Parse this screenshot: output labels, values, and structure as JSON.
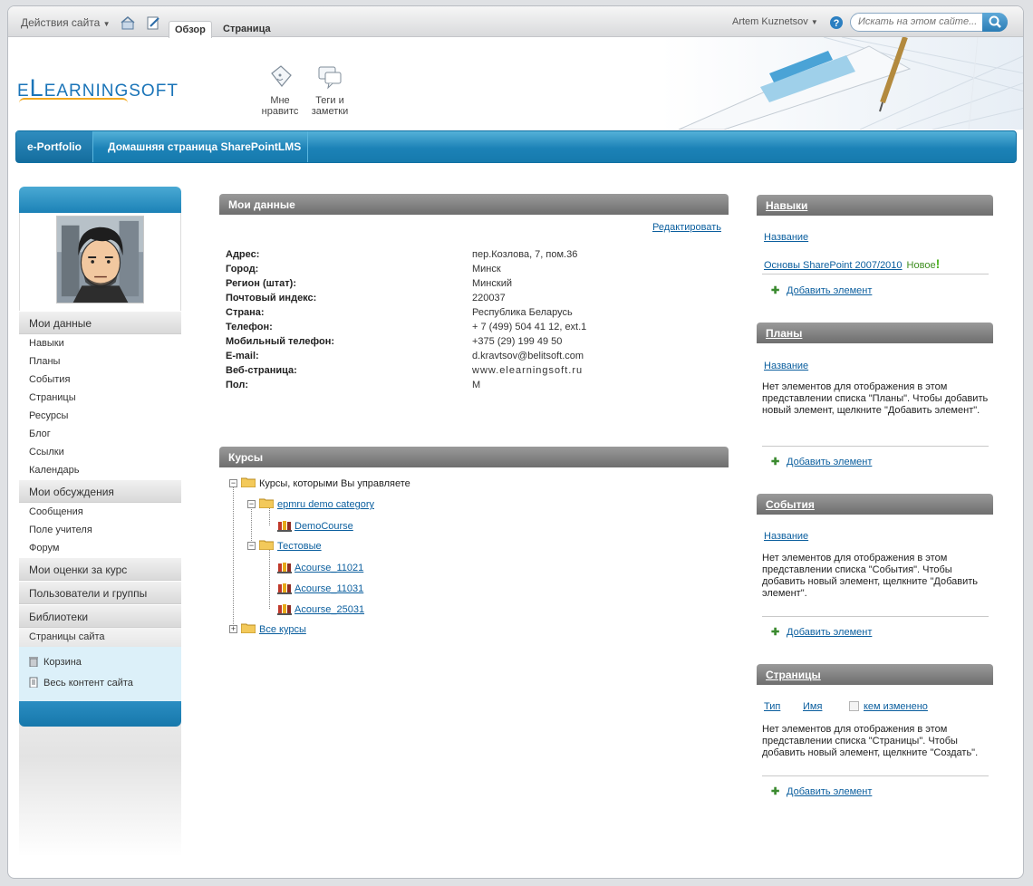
{
  "ribbon": {
    "site_actions": "Действия сайта",
    "tabs": [
      "Обзор",
      "Страница"
    ],
    "user": "Artem Kuznetsov",
    "search_placeholder": "Искать на этом сайте..."
  },
  "header": {
    "logo": "eLearningsoft",
    "like_label": "Мне нравитс",
    "tags_label": "Теги и заметки"
  },
  "topnav": {
    "items": [
      "e-Portfolio",
      "Домашняя страница SharePointLMS"
    ]
  },
  "leftnav": {
    "groups": [
      {
        "label": "Мои данные",
        "items": [
          "Навыки",
          "Планы",
          "События",
          "Страницы",
          "Ресурсы",
          "Блог",
          "Ссылки",
          "Календарь"
        ]
      },
      {
        "label": "Мои обсуждения",
        "items": [
          "Сообщения",
          "Поле учителя",
          "Форум"
        ]
      },
      {
        "label": "Мои оценки за курс",
        "items": []
      },
      {
        "label": "Пользователи и группы",
        "items": []
      },
      {
        "label": "Библиотеки",
        "items": [
          "Страницы сайта"
        ]
      }
    ],
    "extra": [
      "Корзина",
      "Весь контент сайта"
    ]
  },
  "mydata": {
    "title": "Мои данные",
    "edit": "Редактировать",
    "fields": [
      {
        "label": "Адрес:",
        "value": "пер.Козлова, 7, пом.36"
      },
      {
        "label": "Город:",
        "value": "Минск"
      },
      {
        "label": "Регион (штат):",
        "value": "Минский"
      },
      {
        "label": "Почтовый индекс:",
        "value": "220037"
      },
      {
        "label": "Страна:",
        "value": "Республика Беларусь"
      },
      {
        "label": "Телефон:",
        "value": "+ 7 (499) 504 41 12, ext.1"
      },
      {
        "label": "Мобильный телефон:",
        "value": "+375 (29) 199 49 50"
      },
      {
        "label": "E-mail:",
        "value": "d.kravtsov@belitsoft.com"
      },
      {
        "label": "Веб-страница:",
        "value": "www.elearningsoft.ru"
      },
      {
        "label": "Пол:",
        "value": "M"
      }
    ]
  },
  "courses": {
    "title": "Курсы",
    "root": "Курсы, которыми Вы управляете",
    "cat1": "epmru demo category",
    "cat1_course": "DemoCourse",
    "cat2": "Тестовые",
    "cat2_courses": [
      "Acourse_11021",
      "Acourse_11031",
      "Acourse_25031"
    ],
    "all": "Все курсы"
  },
  "skills": {
    "title": "Навыки",
    "column": "Название",
    "item": "Основы SharePoint 2007/2010",
    "new": "Новое",
    "add": "Добавить элемент"
  },
  "plans": {
    "title": "Планы",
    "column": "Название",
    "empty": "Нет элементов для отображения в этом представлении списка \"Планы\". Чтобы добавить новый элемент, щелкните \"Добавить элемент\".",
    "add": "Добавить элемент"
  },
  "events": {
    "title": "События",
    "column": "Название",
    "empty": "Нет элементов для отображения в этом представлении списка \"События\". Чтобы добавить новый элемент, щелкните \"Добавить элемент\".",
    "add": "Добавить элемент"
  },
  "pages": {
    "title": "Страницы",
    "columns": [
      "Тип",
      "Имя",
      "кем изменено"
    ],
    "empty": "Нет элементов для отображения в этом представлении списка \"Страницы\". Чтобы добавить новый элемент, щелкните \"Создать\".",
    "add": "Добавить элемент"
  }
}
